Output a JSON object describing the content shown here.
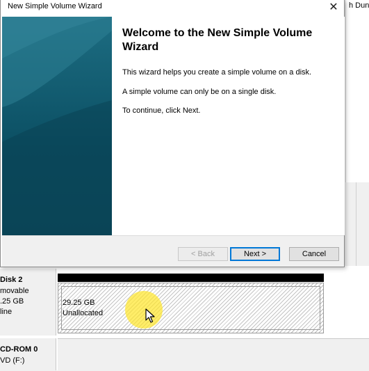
{
  "window": {
    "title": "New Simple Volume Wizard",
    "close_glyph": "✕"
  },
  "wizard": {
    "heading": "Welcome to the New Simple Volume Wizard",
    "paragraphs": [
      "This wizard helps you create a simple volume on a disk.",
      "A simple volume can only be on a single disk.",
      "To continue, click Next."
    ]
  },
  "buttons": {
    "back": "< Back",
    "next": "Next >",
    "cancel": "Cancel"
  },
  "background": {
    "partial_header": "h Dun",
    "disk2": {
      "lines": [
        "Disk 2",
        "movable",
        ".25 GB",
        "line"
      ],
      "unallocated_size": "29.25 GB",
      "unallocated_label": "Unallocated"
    },
    "cdrom": {
      "lines": [
        "CD-ROM 0",
        "VD (F:)"
      ]
    }
  },
  "colors": {
    "banner": "#0b4f63",
    "default_button_border": "#0078d7",
    "cursor_highlight": "#ffe628"
  },
  "icons": {
    "close": "close-icon",
    "cursor": "mouse-pointer-icon"
  }
}
